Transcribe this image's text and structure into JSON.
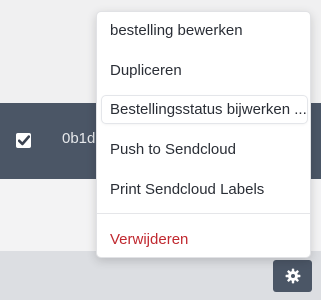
{
  "row": {
    "id_fragment": "0b1d",
    "checked": true
  },
  "menu": {
    "items": [
      {
        "label": "bestelling bewerken"
      },
      {
        "label": "Dupliceren"
      },
      {
        "label": "Bestellingsstatus bijwerken ..."
      },
      {
        "label": "Push to Sendcloud"
      },
      {
        "label": "Print Sendcloud Labels"
      },
      {
        "label": "Verwijderen"
      }
    ]
  },
  "icons": {
    "checkbox": "checkmark-icon",
    "gear": "gear-icon"
  },
  "colors": {
    "row_background": "#4b5666",
    "danger_text": "#c0282f"
  }
}
